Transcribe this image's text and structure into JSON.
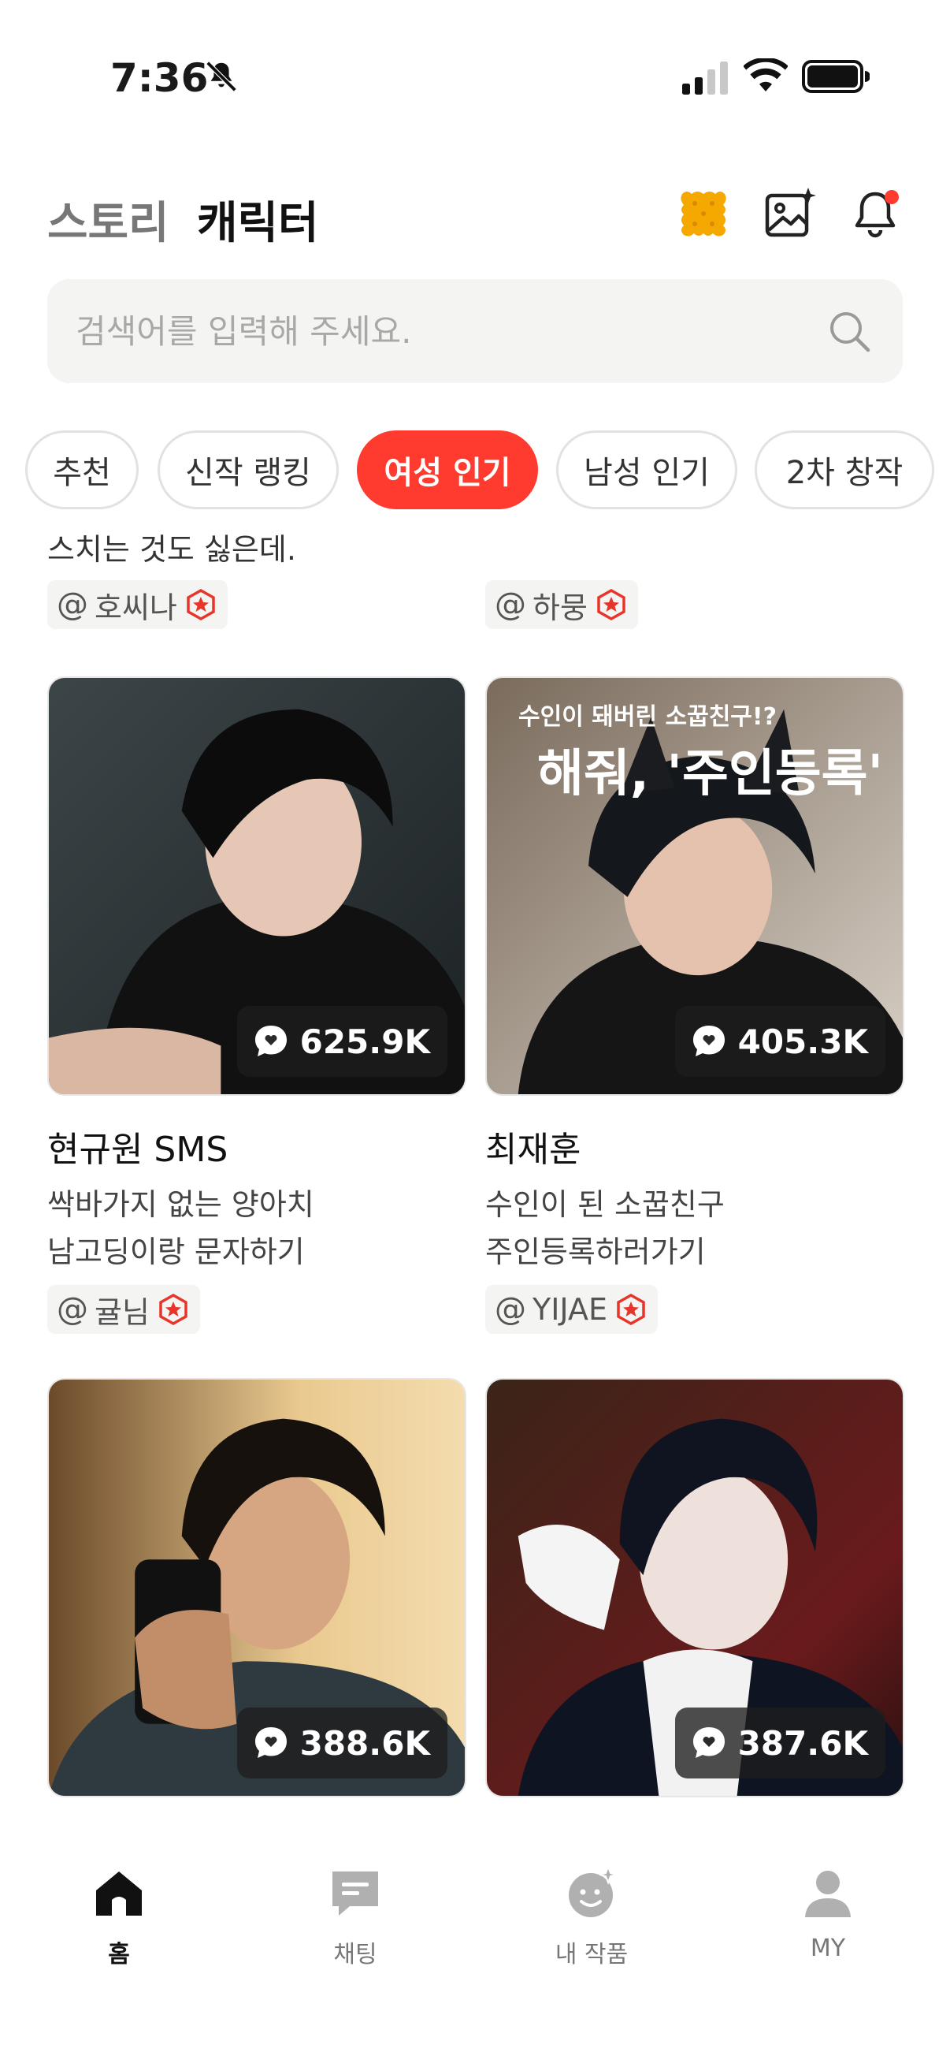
{
  "status_bar": {
    "time": "7:36"
  },
  "header": {
    "tabs": [
      {
        "label": "스토리",
        "active": false
      },
      {
        "label": "캐릭터",
        "active": true
      }
    ]
  },
  "search": {
    "placeholder": "검색어를 입력해 주세요."
  },
  "filters": [
    "추천",
    "신작 랭킹",
    "여성 인기",
    "남성 인기",
    "2차 창작"
  ],
  "active_filter": "여성 인기",
  "peek_row": {
    "description_tail": "스치는 것도 싫은데.",
    "creators": [
      "호씨나",
      "하뭉"
    ]
  },
  "cards": [
    {
      "name": "현규원 SMS",
      "description": [
        "싹바가지 없는 양아치",
        "남고딩이랑 문자하기"
      ],
      "creator": "귤님",
      "chat_count": "625.9K"
    },
    {
      "name": "최재훈",
      "description": [
        "수인이 된 소꿉친구",
        "주인등록하러가기"
      ],
      "creator": "YIJAE",
      "chat_count": "405.3K",
      "image_text": [
        "수인이 돼버린 소꿉친구!?",
        "해줘, '주인등록'"
      ]
    },
    {
      "chat_count": "388.6K"
    },
    {
      "chat_count": "387.6K"
    }
  ],
  "bottom_nav": [
    {
      "label": "홈",
      "icon": "home-icon",
      "active": true
    },
    {
      "label": "채팅",
      "icon": "chat-icon",
      "active": false
    },
    {
      "label": "내 작품",
      "icon": "my-works-icon",
      "active": false
    },
    {
      "label": "MY",
      "icon": "profile-icon",
      "active": false
    }
  ],
  "colors": {
    "accent": "#ff3b30",
    "cookie": "#f5a800",
    "badge": "#e8352b"
  }
}
